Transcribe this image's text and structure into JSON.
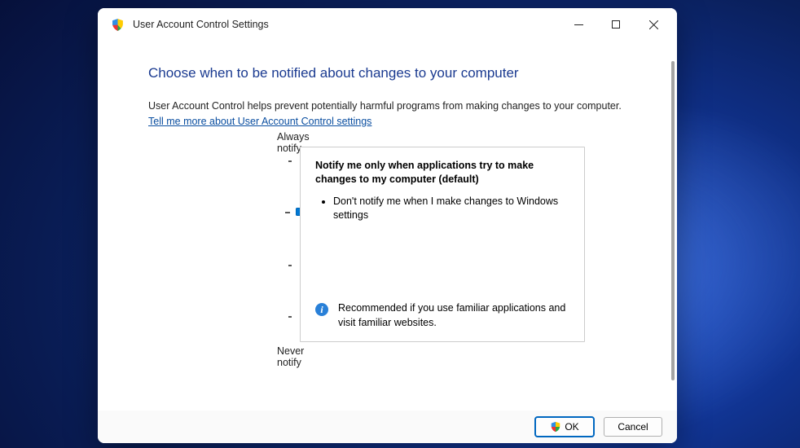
{
  "window": {
    "title": "User Account Control Settings"
  },
  "content": {
    "heading": "Choose when to be notified about changes to your computer",
    "intro": "User Account Control helps prevent potentially harmful programs from making changes to your computer.",
    "learn_more": "Tell me more about User Account Control settings"
  },
  "slider": {
    "top_label": "Always notify",
    "bottom_label": "Never notify",
    "selected_index": 1
  },
  "level": {
    "title": "Notify me only when applications try to make changes to my computer (default)",
    "bullet1": "Don't notify me when I make changes to Windows settings",
    "recommendation": "Recommended if you use familiar applications and visit familiar websites."
  },
  "buttons": {
    "ok": "OK",
    "cancel": "Cancel"
  }
}
